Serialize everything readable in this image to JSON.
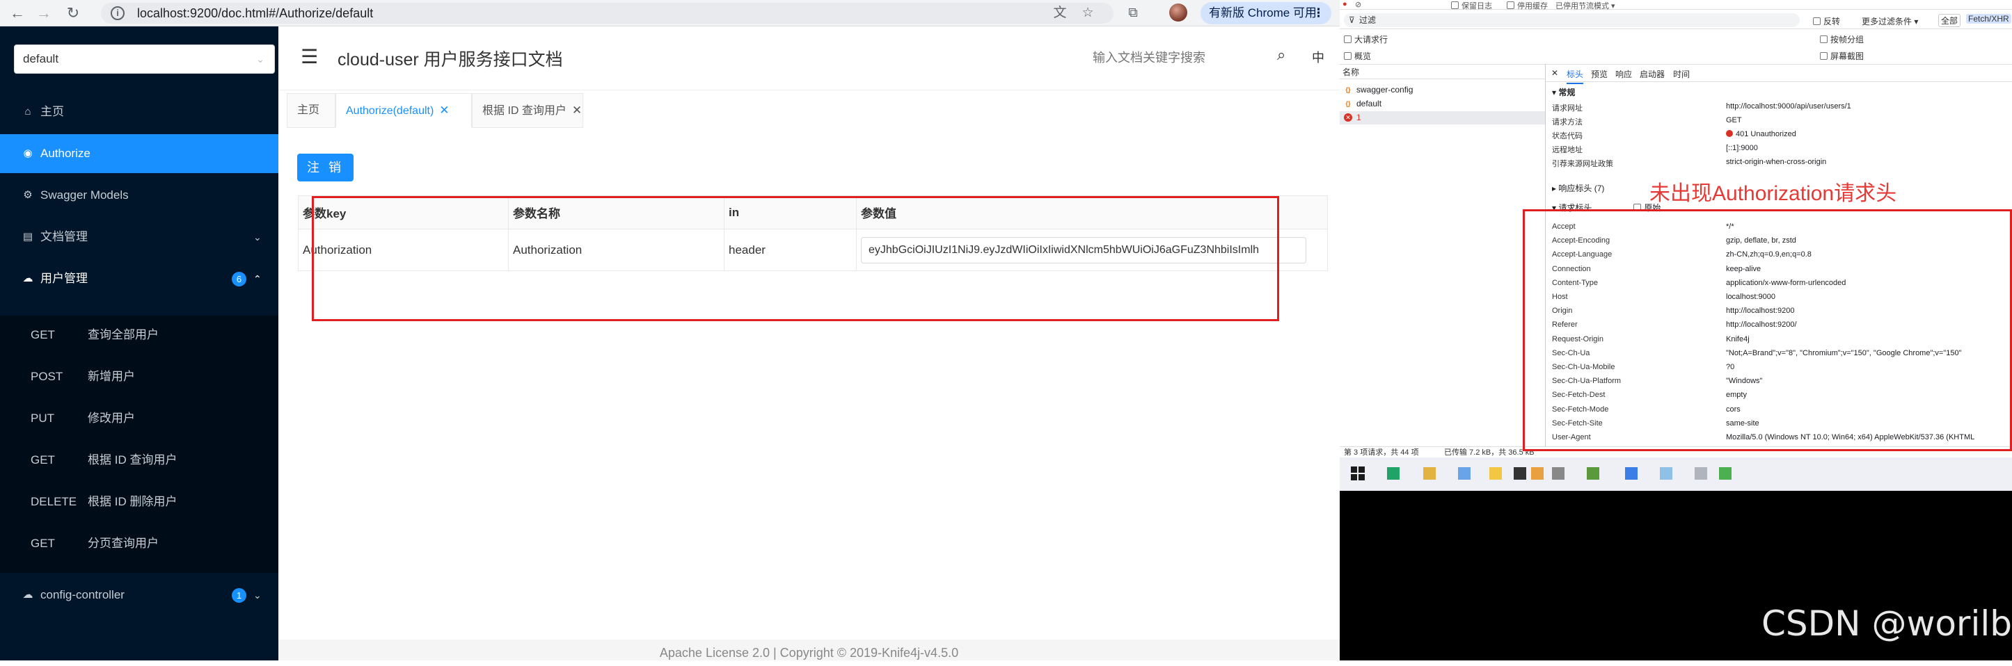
{
  "browser": {
    "url": "localhost:9200/doc.html#/Authorize/default",
    "update_label": "有新版 Chrome 可用"
  },
  "sidebar": {
    "group_select": "default",
    "items": [
      {
        "label": "主页",
        "icon": "home-icon"
      },
      {
        "label": "Authorize",
        "icon": "auth-icon"
      },
      {
        "label": "Swagger Models",
        "icon": "gear-icon"
      },
      {
        "label": "文档管理",
        "icon": "doc-icon"
      },
      {
        "label": "用户管理",
        "icon": "cloud-icon",
        "badge": "6"
      }
    ],
    "apis": [
      {
        "method": "GET",
        "title": "查询全部用户"
      },
      {
        "method": "POST",
        "title": "新增用户"
      },
      {
        "method": "PUT",
        "title": "修改用户"
      },
      {
        "method": "GET",
        "title": "根据 ID 查询用户"
      },
      {
        "method": "DELETE",
        "title": "根据 ID 删除用户"
      },
      {
        "method": "GET",
        "title": "分页查询用户"
      }
    ],
    "config": {
      "label": "config-controller",
      "badge": "1"
    }
  },
  "header": {
    "title": "cloud-user 用户服务接口文档",
    "search_placeholder": "输入文档关键字搜索",
    "lang": "中"
  },
  "tabs": [
    {
      "label": "主页"
    },
    {
      "label": "Authorize(default)"
    },
    {
      "label": "根据 ID 查询用户"
    }
  ],
  "auth": {
    "logout_label": "注 销",
    "columns": [
      "参数key",
      "参数名称",
      "in",
      "参数值"
    ],
    "row": {
      "key": "Authorization",
      "name": "Authorization",
      "in": "header",
      "value": "eyJhbGciOiJIUzI1NiJ9.eyJzdWIiOiIxIiwidXNlcm5hbWUiOiJ6aGFuZ3NhbiIsImlh"
    }
  },
  "footer": "Apache License 2.0 | Copyright © 2019-Knife4j-v4.5.0",
  "devtools": {
    "top": [
      "保留日志",
      "停用缓存",
      "已停用节流模式"
    ],
    "filter": "过滤",
    "filter_right": [
      "反转",
      "更多过滤条件 ▾",
      "全部",
      "Fetch/XHR"
    ],
    "options": [
      "大请求行",
      "概览",
      "按帧分组",
      "屏幕截图"
    ],
    "list_header": "名称",
    "requests": [
      "swagger-config",
      "default",
      "1"
    ],
    "detail_tabs": [
      "标头",
      "预览",
      "响应",
      "启动器",
      "时间"
    ],
    "general_title": "常规",
    "general": [
      {
        "k": "请求网址",
        "v": "http://localhost:9000/api/user/users/1"
      },
      {
        "k": "请求方法",
        "v": "GET"
      },
      {
        "k": "状态代码",
        "v": "401 Unauthorized"
      },
      {
        "k": "远程地址",
        "v": "[::1]:9000"
      },
      {
        "k": "引荐来源网址政策",
        "v": "strict-origin-when-cross-origin"
      }
    ],
    "response_headers_title": "响应标头 (7)",
    "request_headers_title": "请求标头",
    "raw_label": "原始",
    "request_headers": [
      {
        "k": "Accept",
        "v": "*/*"
      },
      {
        "k": "Accept-Encoding",
        "v": "gzip, deflate, br, zstd"
      },
      {
        "k": "Accept-Language",
        "v": "zh-CN,zh;q=0.9,en;q=0.8"
      },
      {
        "k": "Connection",
        "v": "keep-alive"
      },
      {
        "k": "Content-Type",
        "v": "application/x-www-form-urlencoded"
      },
      {
        "k": "Host",
        "v": "localhost:9000"
      },
      {
        "k": "Origin",
        "v": "http://localhost:9200"
      },
      {
        "k": "Referer",
        "v": "http://localhost:9200/"
      },
      {
        "k": "Request-Origin",
        "v": "Knife4j"
      },
      {
        "k": "Sec-Ch-Ua",
        "v": "\"Not;A=Brand\";v=\"8\", \"Chromium\";v=\"150\", \"Google Chrome\";v=\"150\""
      },
      {
        "k": "Sec-Ch-Ua-Mobile",
        "v": "?0"
      },
      {
        "k": "Sec-Ch-Ua-Platform",
        "v": "\"Windows\""
      },
      {
        "k": "Sec-Fetch-Dest",
        "v": "empty"
      },
      {
        "k": "Sec-Fetch-Mode",
        "v": "cors"
      },
      {
        "k": "Sec-Fetch-Site",
        "v": "same-site"
      },
      {
        "k": "User-Agent",
        "v": "Mozilla/5.0 (Windows NT 10.0; Win64; x64) AppleWebKit/537.36 (KHTML"
      }
    ],
    "status_bar": [
      "第 3 项请求，共 44 项",
      "已传输 7.2 kB，共 36.5 kB"
    ]
  },
  "annotation": "未出现Authorization请求头",
  "watermark": "CSDN @worilb",
  "colors": {
    "accent": "#1890ff",
    "sidebar": "#001529",
    "highlight": "#e02020"
  }
}
